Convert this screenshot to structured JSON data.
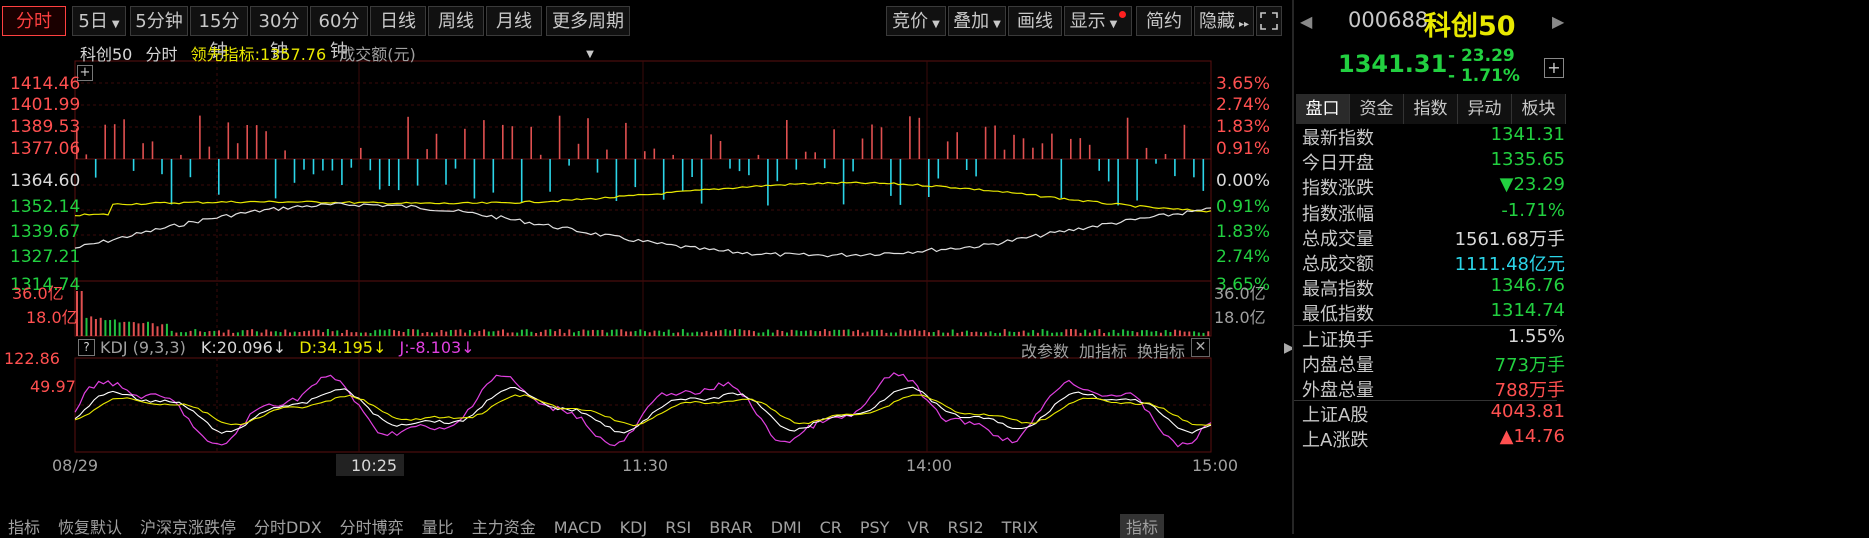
{
  "toolbar": {
    "left_buttons": [
      "分时",
      "5日",
      "5分钟",
      "15分钟",
      "30分钟",
      "60分钟",
      "日线",
      "周线",
      "月线",
      "更多周期"
    ],
    "right_buttons": [
      "竞价",
      "叠加",
      "画线",
      "显示",
      "简约",
      "隐藏"
    ]
  },
  "chart_header": {
    "name": "科创50",
    "mode": "分时",
    "lead_label": "领先指标:1357.76",
    "amount_label": "成交额(元)"
  },
  "price_axis": [
    "1414.46",
    "1401.99",
    "1389.53",
    "1377.06",
    "1364.60",
    "1352.14",
    "1339.67",
    "1327.21",
    "1314.74"
  ],
  "pct_axis": [
    "3.65%",
    "2.74%",
    "1.83%",
    "0.91%",
    "0.00%",
    "0.91%",
    "1.83%",
    "2.74%",
    "3.65%"
  ],
  "volume_axis": [
    "36.0亿",
    "18.0亿"
  ],
  "kdj": {
    "title": "KDJ (9,3,3)",
    "k": "K:20.096↓",
    "d": "D:34.195↓",
    "j": "J:-8.103↓",
    "actions": [
      "改参数",
      "加指标",
      "换指标"
    ],
    "axis": [
      "122.86",
      "49.97"
    ]
  },
  "time_axis": [
    "08/29",
    "10:25",
    "11:30",
    "14:00",
    "15:00"
  ],
  "bottom_tabs": [
    "指标",
    "恢复默认",
    "沪深京涨跌停",
    "分时DDX",
    "分时博弈",
    "量比",
    "主力资金",
    "MACD",
    "KDJ",
    "RSI",
    "BRAR",
    "DMI",
    "CR",
    "PSY",
    "VR",
    "RSI2",
    "TRIX",
    "指标"
  ],
  "panel": {
    "code": "000688",
    "name": "科创50",
    "price": "1341.31",
    "change": "- 23.29",
    "change_pct": "- 1.71%",
    "tabs": [
      "盘口",
      "资金",
      "指数",
      "异动",
      "板块"
    ],
    "rows": [
      {
        "k": "最新指数",
        "v": "1341.31",
        "c": "grn"
      },
      {
        "k": "今日开盘",
        "v": "1335.65",
        "c": "grn"
      },
      {
        "k": "指数涨跌",
        "v": "▼23.29",
        "c": "grn"
      },
      {
        "k": "指数涨幅",
        "v": "-1.71%",
        "c": "grn"
      },
      {
        "k": "总成交量",
        "v": "1561.68万手",
        "c": "wht"
      },
      {
        "k": "总成交额",
        "v": "1111.48亿元",
        "c": "cyn"
      },
      {
        "k": "最高指数",
        "v": "1346.76",
        "c": "grn"
      },
      {
        "k": "最低指数",
        "v": "1314.74",
        "c": "grn"
      },
      {
        "k": "上证换手",
        "v": "1.55%",
        "c": "wht"
      },
      {
        "k": "内盘总量",
        "v": "773万手",
        "c": "grn"
      },
      {
        "k": "外盘总量",
        "v": "788万手",
        "c": "red"
      },
      {
        "k": "上证A股",
        "v": "4043.81",
        "c": "red"
      },
      {
        "k": "上A涨跌",
        "v": "▲14.76",
        "c": "red"
      }
    ]
  },
  "colors": {
    "up": "#ff5050",
    "down": "#22d040",
    "lead": "#e8e800",
    "price": "#d8d8d8",
    "kdj_j": "#e040e0",
    "bar_down": "#2bd5e8"
  }
}
